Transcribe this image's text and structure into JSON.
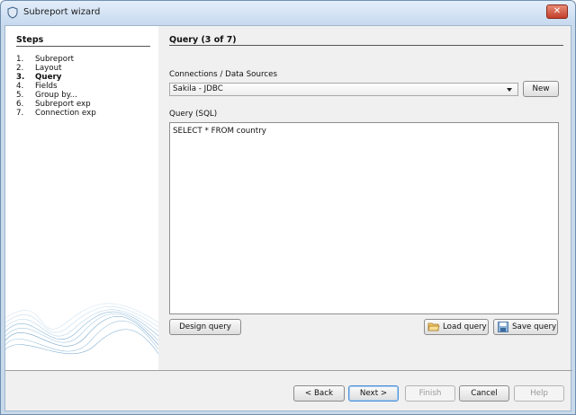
{
  "window": {
    "title": "Subreport wizard",
    "close_label": "✕"
  },
  "steps": {
    "title": "Steps",
    "items": [
      {
        "num": "1.",
        "label": "Subreport"
      },
      {
        "num": "2.",
        "label": "Layout"
      },
      {
        "num": "3.",
        "label": "Query"
      },
      {
        "num": "4.",
        "label": "Fields"
      },
      {
        "num": "5.",
        "label": "Group by..."
      },
      {
        "num": "6.",
        "label": "Subreport exp"
      },
      {
        "num": "7.",
        "label": "Connection exp"
      }
    ],
    "current_index": 2
  },
  "content": {
    "title": "Query (3 of 7)",
    "connections_label": "Connections / Data Sources",
    "connection_selected": "Sakila - JDBC",
    "new_button": "New",
    "query_label": "Query (SQL)",
    "query_text": "SELECT * FROM country",
    "design_query_button": "Design query",
    "load_query_button": "Load query",
    "save_query_button": "Save query"
  },
  "footer": {
    "back_button": "< Back",
    "next_button": "Next >",
    "finish_button": "Finish",
    "cancel_button": "Cancel",
    "help_button": "Help"
  },
  "icons": {
    "app": "app-shield-icon",
    "load": "folder-open-icon",
    "save": "floppy-disk-icon"
  },
  "colors": {
    "titlebar": "#c7daf0",
    "close": "#c3402a",
    "focus": "#4d90d6"
  }
}
